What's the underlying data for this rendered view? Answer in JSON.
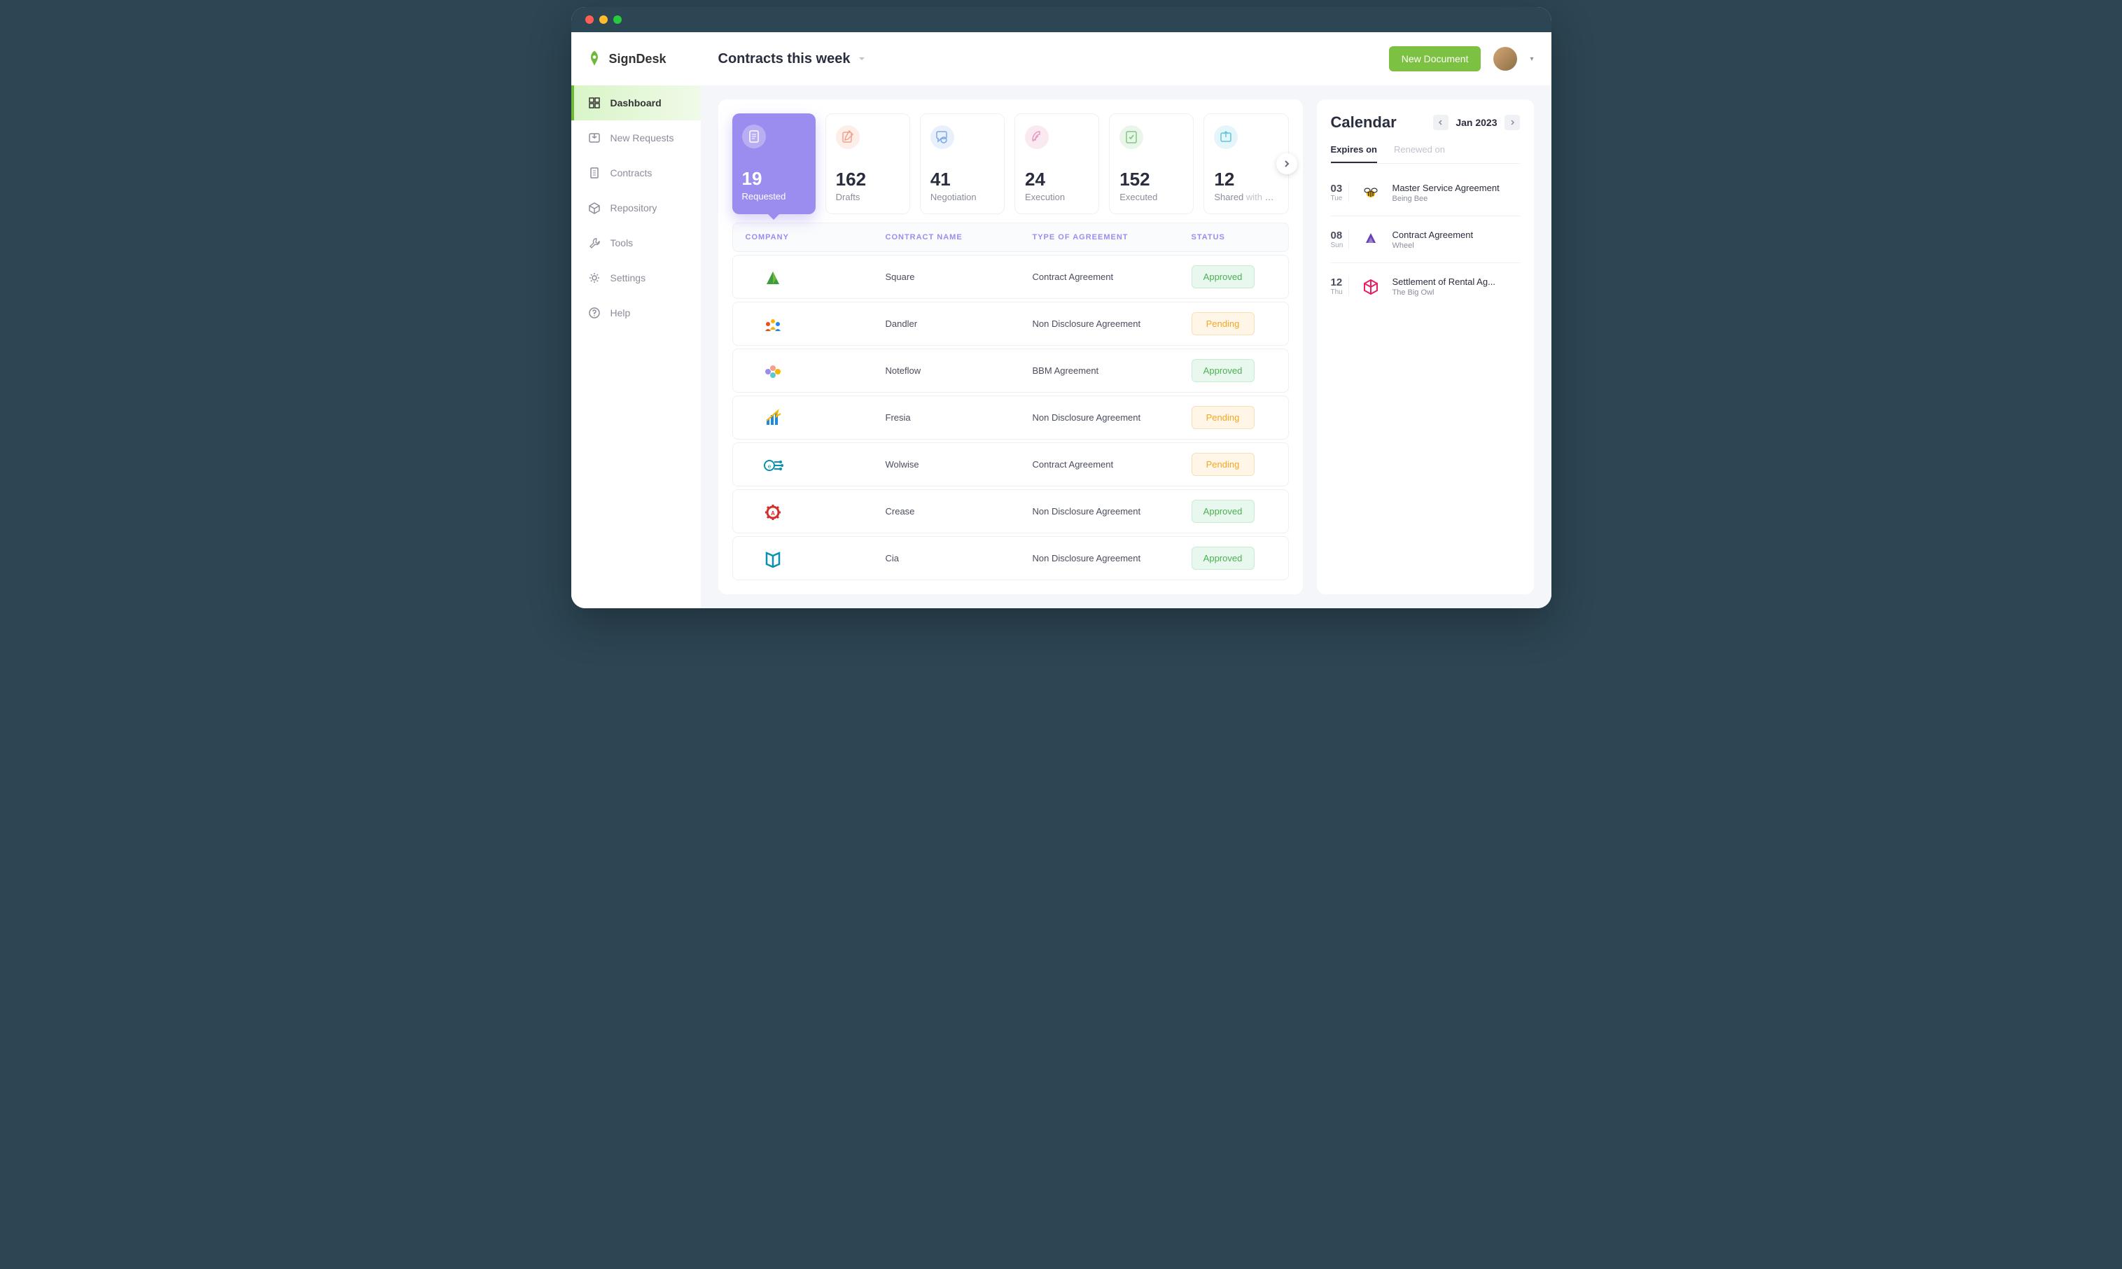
{
  "brand": "SignDesk",
  "header": {
    "title": "Contracts this week",
    "new_document": "New Document"
  },
  "sidebar": [
    {
      "icon": "dashboard",
      "label": "Dashboard",
      "active": true
    },
    {
      "icon": "inbox",
      "label": "New Requests"
    },
    {
      "icon": "document",
      "label": "Contracts"
    },
    {
      "icon": "box",
      "label": "Repository"
    },
    {
      "icon": "wrench",
      "label": "Tools"
    },
    {
      "icon": "gear",
      "label": "Settings"
    },
    {
      "icon": "help",
      "label": "Help"
    }
  ],
  "cards": [
    {
      "icon": "doc",
      "color": "#ffffff",
      "bg": "rgba(255,255,255,0.3)",
      "num": "19",
      "label": "Requested",
      "active": true
    },
    {
      "icon": "edit",
      "color": "#f4a08b",
      "bg": "#fdeee9",
      "num": "162",
      "label": "Drafts"
    },
    {
      "icon": "chat",
      "color": "#7aa8e8",
      "bg": "#e8f0fb",
      "num": "41",
      "label": "Negotiation"
    },
    {
      "icon": "feather",
      "color": "#e89bc1",
      "bg": "#fbe9f2",
      "num": "24",
      "label": "Execution"
    },
    {
      "icon": "check",
      "color": "#7fc97f",
      "bg": "#e9f6e9",
      "num": "152",
      "label": "Executed"
    },
    {
      "icon": "share",
      "color": "#5fc6d6",
      "bg": "#e4f6f9",
      "num": "12",
      "label": "Shared",
      "label_suffix": " with you"
    }
  ],
  "table": {
    "headers": [
      "COMPANY",
      "CONTRACT NAME",
      "TYPE OF AGREEMENT",
      "STATUS"
    ],
    "rows": [
      {
        "logo": "tri-green",
        "name": "Square",
        "type": "Contract Agreement",
        "status": "Approved"
      },
      {
        "logo": "people",
        "name": "Dandler",
        "type": "Non Disclosure Agreement",
        "status": "Pending"
      },
      {
        "logo": "flower",
        "name": "Noteflow",
        "type": "BBM Agreement",
        "status": "Approved"
      },
      {
        "logo": "bars",
        "name": "Fresia",
        "type": "Non Disclosure Agreement",
        "status": "Pending"
      },
      {
        "logo": "circuit",
        "name": "Wolwise",
        "type": "Contract Agreement",
        "status": "Pending"
      },
      {
        "logo": "gear-red",
        "name": "Crease",
        "type": "Non Disclosure Agreement",
        "status": "Approved"
      },
      {
        "logo": "book",
        "name": "Cia",
        "type": "Non Disclosure Agreement",
        "status": "Approved"
      }
    ]
  },
  "calendar": {
    "title": "Calendar",
    "month": "Jan 2023",
    "tabs": [
      "Expires on",
      "Renewed on"
    ],
    "items": [
      {
        "day": "03",
        "wd": "Tue",
        "logo": "bee",
        "title": "Master Service Agreement",
        "sub": "Being Bee"
      },
      {
        "day": "08",
        "wd": "Sun",
        "logo": "wheel",
        "title": "Contract Agreement",
        "sub": "Wheel"
      },
      {
        "day": "12",
        "wd": "Thu",
        "logo": "cube",
        "title": "Settlement of Rental Ag...",
        "sub": "The Big Owl"
      }
    ]
  }
}
